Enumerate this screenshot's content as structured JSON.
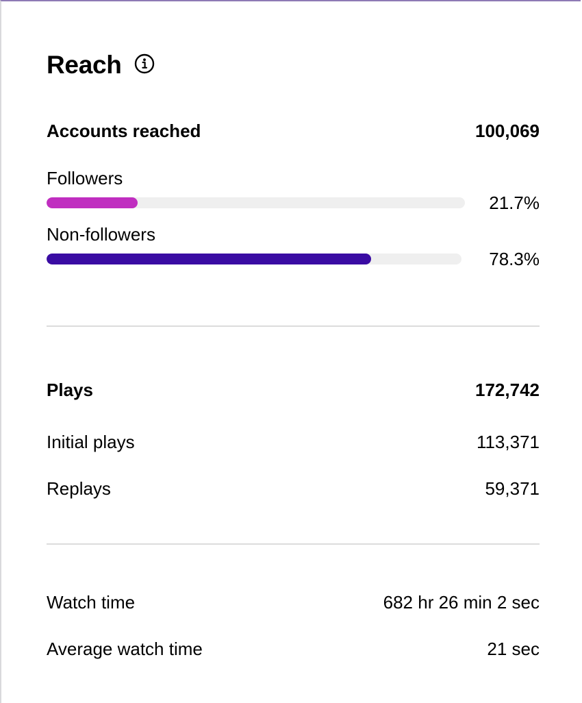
{
  "reach": {
    "title": "Reach",
    "info_icon": "info-icon"
  },
  "accounts_reached": {
    "label": "Accounts reached",
    "value": "100,069"
  },
  "followers": {
    "label": "Followers",
    "percent_label": "21.7%",
    "fraction": 0.217,
    "color": "#c02ec0"
  },
  "non_followers": {
    "label": "Non-followers",
    "percent_label": "78.3%",
    "fraction": 0.783,
    "color": "#3a0ca3"
  },
  "plays": {
    "label": "Plays",
    "value": "172,742",
    "initial_label": "Initial plays",
    "initial_value": "113,371",
    "replays_label": "Replays",
    "replays_value": "59,371"
  },
  "watch": {
    "time_label": "Watch time",
    "time_value": "682 hr 26 min 2 sec",
    "avg_label": "Average watch time",
    "avg_value": "21 sec"
  }
}
